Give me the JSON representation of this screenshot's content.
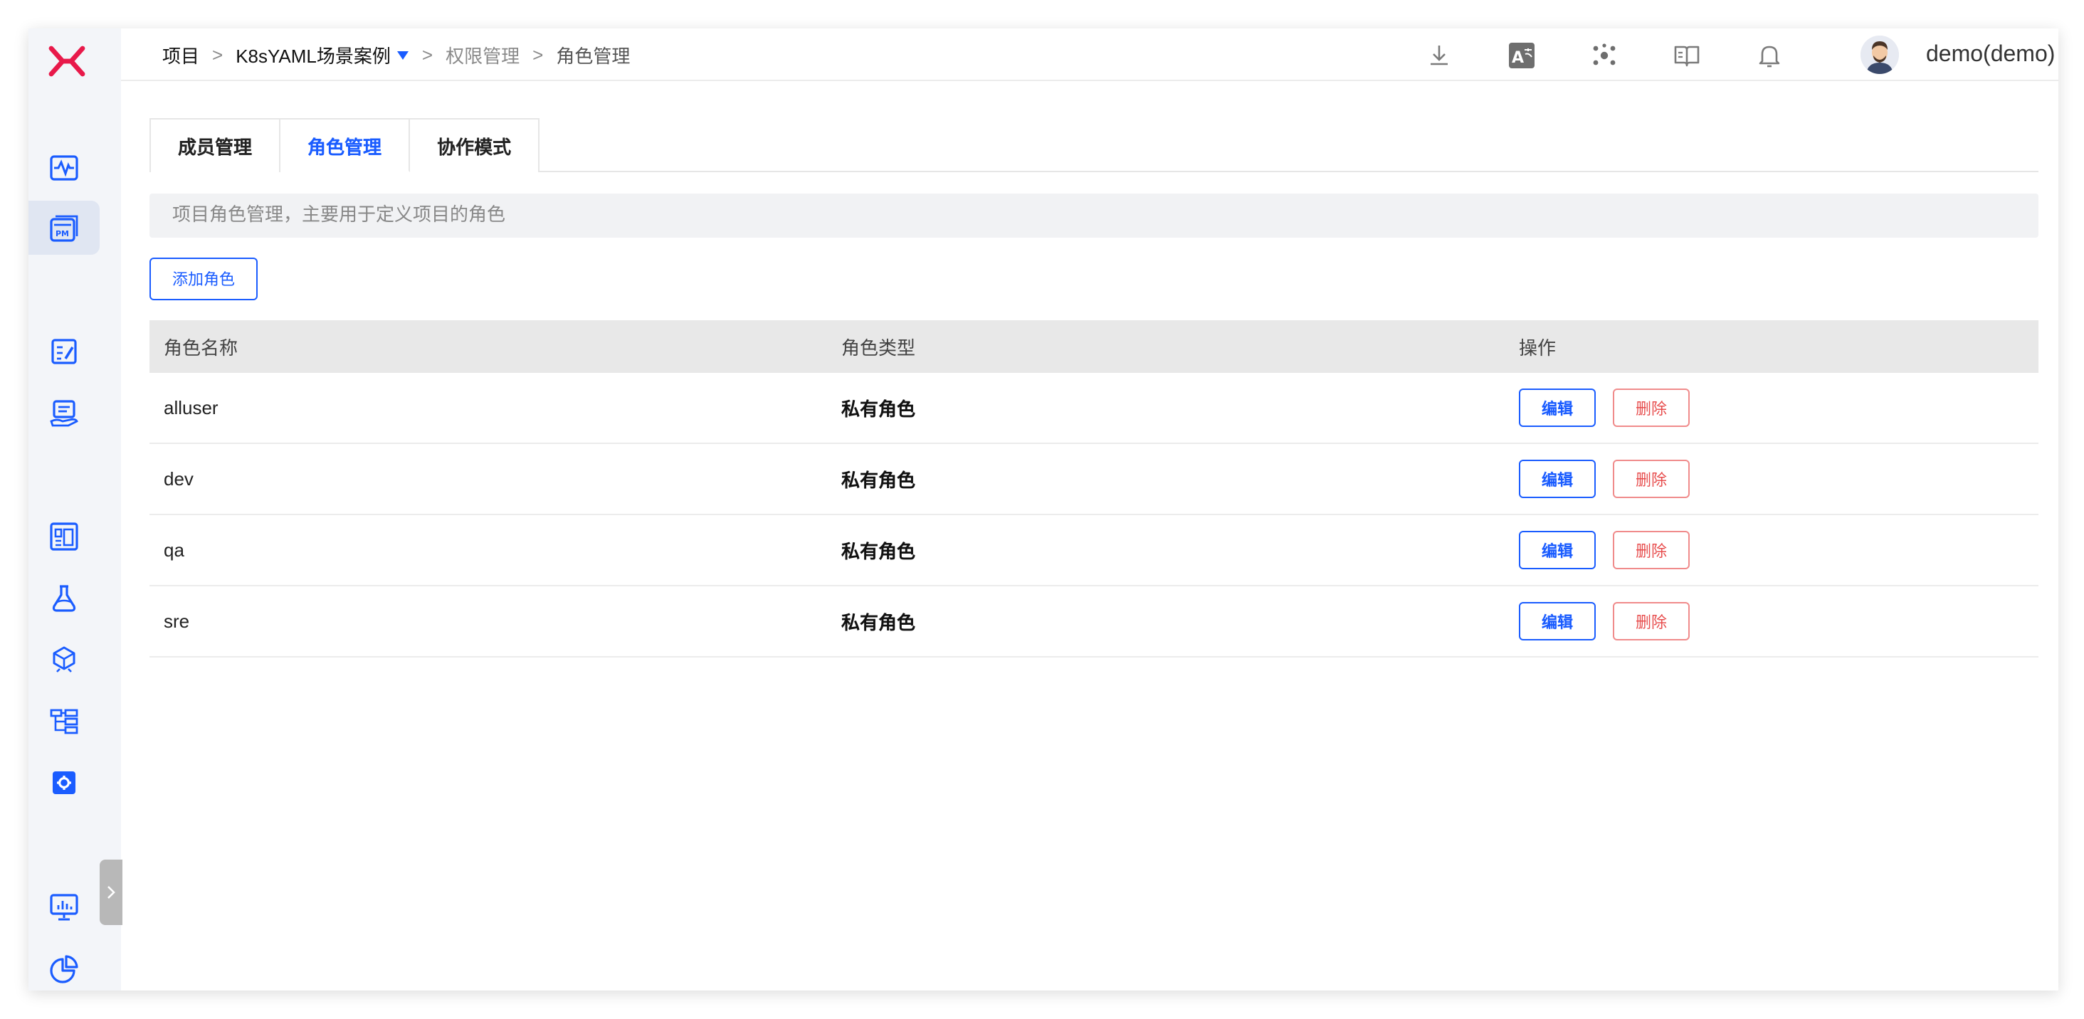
{
  "breadcrumb": {
    "root": "项目",
    "project": "K8sYAML场景案例",
    "section": "权限管理",
    "current": "角色管理",
    "separator": ">"
  },
  "user": {
    "name": "demo(demo)"
  },
  "tabs": [
    {
      "label": "成员管理",
      "active": false
    },
    {
      "label": "角色管理",
      "active": true
    },
    {
      "label": "协作模式",
      "active": false
    }
  ],
  "notice": "项目角色管理，主要用于定义项目的角色",
  "add_button": "添加角色",
  "table": {
    "headers": [
      "角色名称",
      "角色类型",
      "操作"
    ],
    "rows": [
      {
        "name": "alluser",
        "type": "私有角色"
      },
      {
        "name": "dev",
        "type": "私有角色"
      },
      {
        "name": "qa",
        "type": "私有角色"
      },
      {
        "name": "sre",
        "type": "私有角色"
      }
    ],
    "edit_label": "编辑",
    "delete_label": "删除"
  },
  "colors": {
    "accent": "#1a5cff",
    "brand": "#e8194a",
    "danger": "#e74c4c"
  },
  "icons": {
    "sidebar": [
      "monitor-wave-icon",
      "project-pm-icon",
      "document-edit-icon",
      "delivery-icon",
      "workflow-grid-icon",
      "test-flask-icon",
      "package-icon",
      "environment-tree-icon",
      "settings-box-icon",
      "dashboard-chart-icon",
      "pie-chart-icon"
    ],
    "topbar": [
      "download-icon",
      "translate-icon",
      "network-icon",
      "docs-book-icon",
      "bell-icon",
      "more-vertical-icon"
    ]
  }
}
